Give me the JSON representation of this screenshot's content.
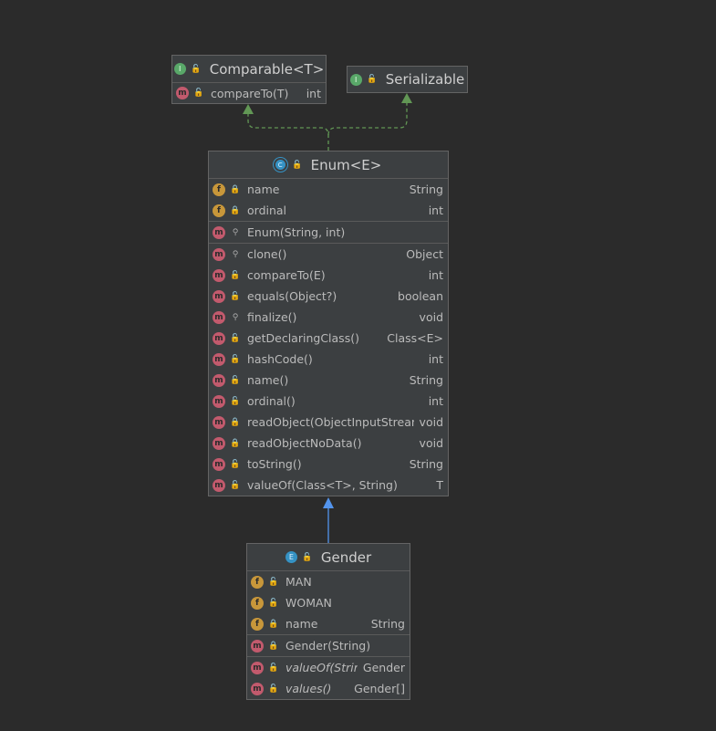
{
  "comparable": {
    "title": "Comparable<T>",
    "kind_icon": "I",
    "members": [
      {
        "icon": "m",
        "vis": "pub",
        "name": "compareTo(T)",
        "type": "int"
      }
    ]
  },
  "serializable": {
    "title": "Serializable",
    "kind_icon": "I"
  },
  "enum": {
    "title": "Enum<E>",
    "kind_icon": "C",
    "fields": [
      {
        "icon": "f",
        "vis": "priv",
        "name": "name",
        "type": "String"
      },
      {
        "icon": "f",
        "vis": "priv",
        "name": "ordinal",
        "type": "int"
      }
    ],
    "constructors": [
      {
        "icon": "m",
        "vis": "pkg",
        "name": "Enum(String, int)",
        "type": ""
      }
    ],
    "methods": [
      {
        "icon": "m",
        "vis": "pkg",
        "name": "clone()",
        "type": "Object"
      },
      {
        "icon": "m",
        "vis": "pub",
        "name": "compareTo(E)",
        "type": "int"
      },
      {
        "icon": "m",
        "vis": "pub",
        "name": "equals(Object?)",
        "type": "boolean"
      },
      {
        "icon": "m",
        "vis": "pkg",
        "name": "finalize()",
        "type": "void"
      },
      {
        "icon": "m",
        "vis": "pub",
        "name": "getDeclaringClass()",
        "type": "Class<E>"
      },
      {
        "icon": "m",
        "vis": "pub",
        "name": "hashCode()",
        "type": "int"
      },
      {
        "icon": "m",
        "vis": "pub",
        "name": "name()",
        "type": "String"
      },
      {
        "icon": "m",
        "vis": "pub",
        "name": "ordinal()",
        "type": "int"
      },
      {
        "icon": "m",
        "vis": "priv",
        "name": "readObject(ObjectInputStream?)",
        "type": "void"
      },
      {
        "icon": "m",
        "vis": "priv",
        "name": "readObjectNoData()",
        "type": "void"
      },
      {
        "icon": "m",
        "vis": "pub",
        "name": "toString()",
        "type": "String"
      },
      {
        "icon": "m",
        "vis": "pub",
        "name": "valueOf(Class<T>, String)",
        "type": "T"
      }
    ]
  },
  "gender": {
    "title": "Gender",
    "kind_icon": "E",
    "fields": [
      {
        "icon": "f",
        "vis": "pub",
        "name": "MAN",
        "type": ""
      },
      {
        "icon": "f",
        "vis": "pub",
        "name": "WOMAN",
        "type": ""
      },
      {
        "icon": "f",
        "vis": "priv",
        "name": "name",
        "type": "String"
      }
    ],
    "constructors": [
      {
        "icon": "m",
        "vis": "priv",
        "name": "Gender(String)",
        "type": ""
      }
    ],
    "methods": [
      {
        "icon": "m",
        "vis": "pub",
        "name": "valueOf(String)",
        "type": "Gender",
        "italic": true
      },
      {
        "icon": "m",
        "vis": "pub",
        "name": "values()",
        "type": "Gender[]",
        "italic": true
      }
    ]
  },
  "colors": {
    "background": "#2b2b2b",
    "panel": "#3c3f41",
    "implements_edge": "#629755",
    "extends_edge": "#5394ec"
  }
}
